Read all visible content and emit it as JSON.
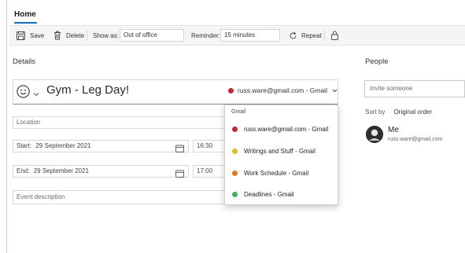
{
  "ribbon": {
    "tab_home": "Home"
  },
  "toolbar": {
    "save_label": "Save",
    "delete_label": "Delete",
    "show_as_label": "Show as:",
    "show_as_value": "Out of office",
    "reminder_label": "Reminder:",
    "reminder_value": "15 minutes",
    "repeat_label": "Repeat"
  },
  "details": {
    "heading": "Details",
    "title": "Gym - Leg Day!",
    "calendar_account": "russ.ware@gmail.com - Gmail",
    "location_placeholder": "Location",
    "start_label": "Start:",
    "start_date": "29 September 2021",
    "start_time": "16:30",
    "end_label": "End:",
    "end_date": "29 September 2021",
    "end_time": "17:00",
    "description_placeholder": "Event description"
  },
  "calendar_dropdown": {
    "group": "Gmail",
    "items": [
      {
        "label": "russ.ware@gmail.com - Gmail",
        "color": "#c4262e"
      },
      {
        "label": "Writings and Stuff - Gmail",
        "color": "#e3b82a"
      },
      {
        "label": "Work Schedule - Gmail",
        "color": "#e07a1f"
      },
      {
        "label": "Deadlines - Gmail",
        "color": "#3cb35a"
      }
    ]
  },
  "people": {
    "heading": "People",
    "invite_placeholder": "Invite someone",
    "sort_label": "Sort by",
    "sort_value": "Original order",
    "me_name": "Me",
    "me_email": "russ.ware@gmail.com"
  },
  "colors": {
    "accent": "#0f6cbd"
  }
}
